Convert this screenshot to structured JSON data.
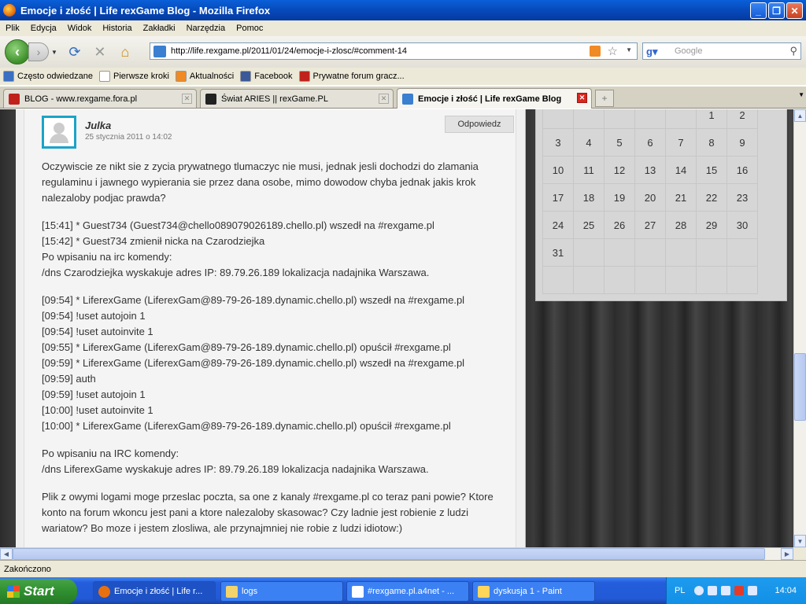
{
  "window": {
    "title": "Emocje i złość | Life rexGame Blog - Mozilla Firefox",
    "min": "_",
    "max": "❐",
    "close": "✕"
  },
  "menu": [
    "Plik",
    "Edycja",
    "Widok",
    "Historia",
    "Zakładki",
    "Narzędzia",
    "Pomoc"
  ],
  "nav": {
    "url": "http://life.rexgame.pl/2011/01/24/emocje-i-zlosc/#comment-14",
    "search_placeholder": "Google"
  },
  "bookmarks": [
    {
      "label": "Często odwiedzane",
      "color": "#3a6fc2"
    },
    {
      "label": "Pierwsze kroki",
      "color": "#ffffff"
    },
    {
      "label": "Aktualności",
      "color": "#f08a24"
    },
    {
      "label": "Facebook",
      "color": "#3b5998"
    },
    {
      "label": "Prywatne forum gracz...",
      "color": "#c0221b"
    }
  ],
  "tabs": [
    {
      "label": "BLOG - www.rexgame.fora.pl",
      "active": false
    },
    {
      "label": "Świat ARIES || rexGame.PL",
      "active": false
    },
    {
      "label": "Emocje i złość | Life rexGame Blog",
      "active": true
    }
  ],
  "comment": {
    "author": "Julka",
    "date": "25 stycznia 2011 o 14:02",
    "reply": "Odpowiedz",
    "paragraphs": [
      [
        "Oczywiscie ze nikt sie z zycia prywatnego tlumaczyc nie musi, jednak jesli dochodzi do zlamania regulaminu i jawnego wypierania sie przez dana osobe, mimo dowodow chyba jednak jakis krok nalezaloby podjac prawda?"
      ],
      [
        "[15:41] * Guest734 (Guest734@chello089079026189.chello.pl) wszedł na #rexgame.pl",
        "[15:42] * Guest734 zmienił nicka na Czarodziejka",
        "Po wpisaniu na irc komendy:",
        "/dns Czarodziejka wyskakuje adres IP: 89.79.26.189 lokalizacja nadajnika Warszawa."
      ],
      [
        "[09:54] * LiferexGame (LiferexGam@89-79-26-189.dynamic.chello.pl) wszedł na #rexgame.pl",
        "[09:54] !uset autojoin 1",
        "[09:54] !uset autoinvite 1",
        "[09:55] * LiferexGame (LiferexGam@89-79-26-189.dynamic.chello.pl) opuścił #rexgame.pl",
        "[09:59] * LiferexGame (LiferexGam@89-79-26-189.dynamic.chello.pl) wszedł na #rexgame.pl",
        "[09:59] auth",
        "[09:59] !uset autojoin 1",
        "[10:00] !uset autoinvite 1",
        "[10:00] * LiferexGame (LiferexGam@89-79-26-189.dynamic.chello.pl) opuścił #rexgame.pl"
      ],
      [
        "Po wpisaniu na IRC komendy:",
        "/dns LiferexGame wyskakuje adres IP: 89.79.26.189 lokalizacja nadajnika Warszawa."
      ],
      [
        "Plik z owymi logami moge przeslac poczta, sa one z kanaly #rexgame.pl co teraz pani powie? Ktore konto na forum wkoncu jest pani a ktore nalezaloby skasowac? Czy ladnie jest robienie z ludzi wariatow? Bo moze i jestem zlosliwa, ale przynajmniej nie robie z ludzi idiotow:)"
      ]
    ]
  },
  "calendar": {
    "rows": [
      [
        "",
        "",
        "",
        "",
        "",
        "1",
        "2"
      ],
      [
        "3",
        "4",
        "5",
        "6",
        "7",
        "8",
        "9"
      ],
      [
        "10",
        "11",
        "12",
        "13",
        "14",
        "15",
        "16"
      ],
      [
        "17",
        "18",
        "19",
        "20",
        "21",
        "22",
        "23"
      ],
      [
        "24",
        "25",
        "26",
        "27",
        "28",
        "29",
        "30"
      ],
      [
        "31",
        "",
        "",
        "",
        "",
        "",
        ""
      ],
      [
        "",
        "",
        "",
        "",
        "",
        "",
        ""
      ]
    ]
  },
  "status": "Zakończono",
  "taskbar": {
    "start": "Start",
    "tasks": [
      {
        "label": "Emocje i złość | Life r...",
        "color": "#e8700f",
        "active": true
      },
      {
        "label": "logs",
        "color": "#f3d36b",
        "active": false
      },
      {
        "label": "#rexgame.pl.a4net - ...",
        "color": "#ffffff",
        "active": false
      },
      {
        "label": "dyskusja 1 - Paint",
        "color": "#ffd65a",
        "active": false
      }
    ],
    "lang": "PL",
    "clock": "14:04"
  }
}
